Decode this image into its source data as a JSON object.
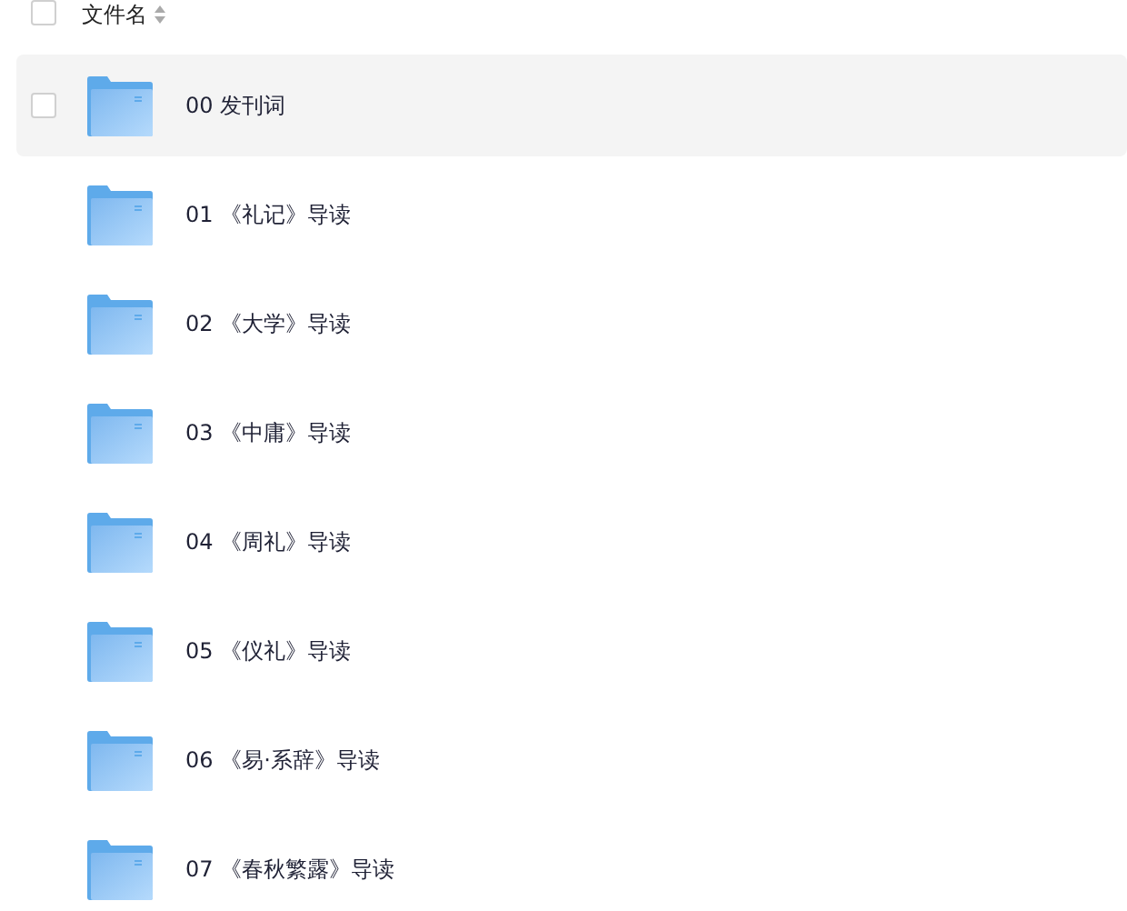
{
  "header": {
    "checkbox": {
      "checked": false
    },
    "column": "文件名"
  },
  "rows": [
    {
      "name": "00 发刊词",
      "hovered": true,
      "checked": false
    },
    {
      "name": "01 《礼记》导读",
      "hovered": false
    },
    {
      "name": "02 《大学》导读",
      "hovered": false
    },
    {
      "name": "03 《中庸》导读",
      "hovered": false
    },
    {
      "name": "04 《周礼》导读",
      "hovered": false
    },
    {
      "name": "05 《仪礼》导读",
      "hovered": false
    },
    {
      "name": "06 《易·系辞》导读",
      "hovered": false
    },
    {
      "name": "07 《春秋繁露》导读",
      "hovered": false
    }
  ]
}
